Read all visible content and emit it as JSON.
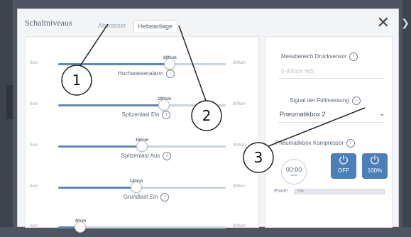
{
  "dialog": {
    "title": "Schaltniveaus",
    "tabs": [
      {
        "label": "Abwasser",
        "active": false
      },
      {
        "label": "Hebeanlage",
        "active": true
      }
    ],
    "close_glyph": "✕"
  },
  "sliders": [
    {
      "name": "hochwasseralarm",
      "label": "Hochwasseralarm",
      "min": "0cm",
      "max": "300cm",
      "value_label": "200cm",
      "value": 200
    },
    {
      "name": "spitzenlast-ein",
      "label": "Spitzenlast Ein",
      "min": "0cm",
      "max": "300cm",
      "value_label": "190cm",
      "value": 190
    },
    {
      "name": "spitzenlast-aus",
      "label": "Spitzenlast Aus",
      "min": "0cm",
      "max": "300cm",
      "value_label": "150cm",
      "value": 150
    },
    {
      "name": "grundlast-ein",
      "label": "Grundlast Ein",
      "min": "0cm",
      "max": "300cm",
      "value_label": "140cm",
      "value": 140
    },
    {
      "name": "grundlast-aus",
      "label": "",
      "min": "0cm",
      "max": "300cm",
      "value_label": "40cm",
      "value": 40
    }
  ],
  "right": {
    "messbereich_label": "Messbereich Drucksensor",
    "messbereich_value": "0-400cm WS",
    "signal_label": "Signal der Füllmessung",
    "signal_value": "Pneumatikbox 2",
    "kompressor_label": "Pneumatikbox Kompressor",
    "time": "00:00",
    "btn_off": "OFF",
    "btn_100": "100%",
    "power_label": "Power",
    "power_value": "0%",
    "power_fraction": 0.0
  },
  "callouts": [
    "1",
    "2",
    "3"
  ],
  "colors": {
    "accent": "#4a7fb8",
    "track": "#c9d4df",
    "fill": "#5e88b6",
    "background": "#4f5661"
  },
  "icons": {
    "info": "info-icon",
    "power": "power-icon",
    "chevron": "chevron-down-icon",
    "close": "close-icon"
  }
}
